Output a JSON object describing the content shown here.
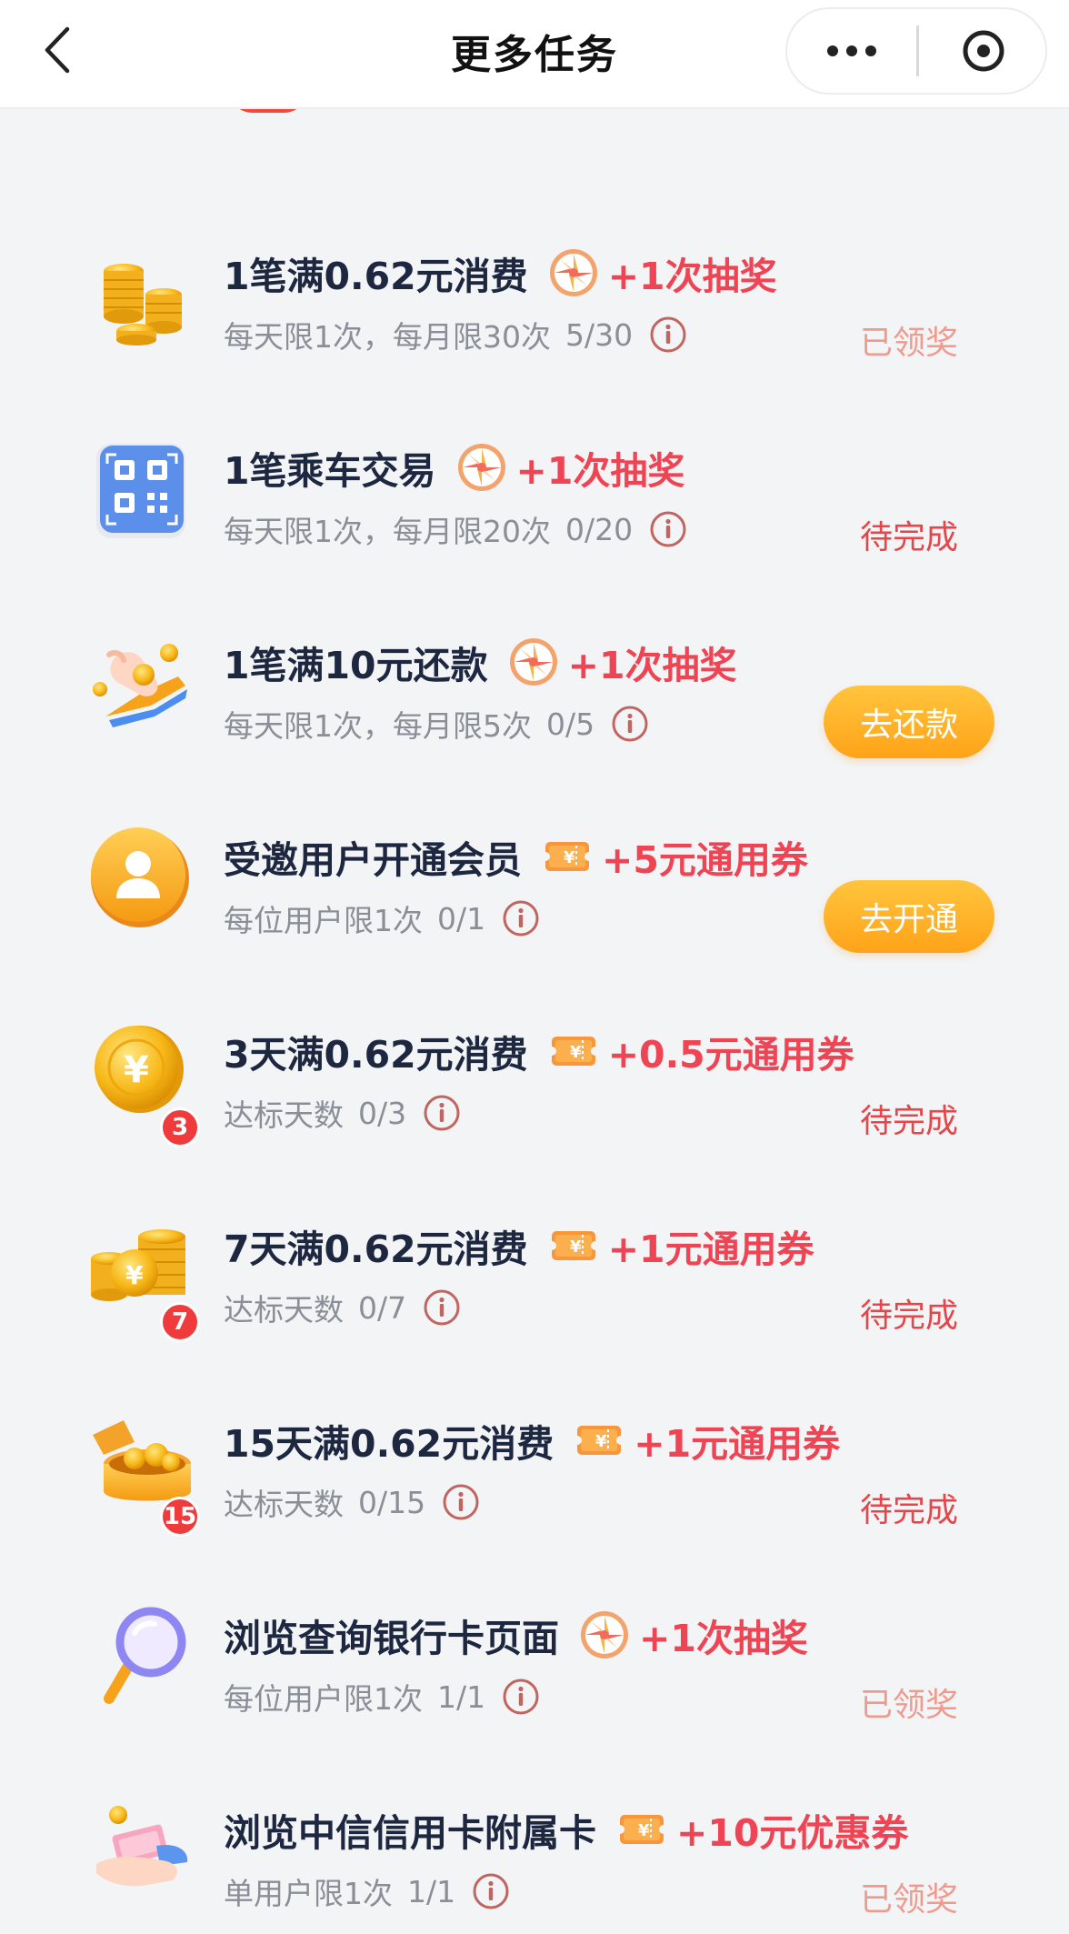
{
  "header": {
    "title": "更多任务"
  },
  "tasks": [
    {
      "title": "1笔满0.62元消费",
      "reward_type": "lottery",
      "reward": "+1次抽奖",
      "limit": "每天限1次，每月限30次",
      "progress": "5/30",
      "status": "已领奖",
      "status_kind": "done",
      "icon": "gold-coins-stack-icon"
    },
    {
      "title": "1笔乘车交易",
      "reward_type": "lottery",
      "reward": "+1次抽奖",
      "limit": "每天限1次，每月限20次",
      "progress": "0/20",
      "status": "待完成",
      "status_kind": "pending",
      "icon": "qr-code-icon"
    },
    {
      "title": "1笔满10元还款",
      "reward_type": "lottery",
      "reward": "+1次抽奖",
      "limit": "每天限1次，每月限5次",
      "progress": "0/5",
      "action": "去还款",
      "icon": "hand-with-coins-icon"
    },
    {
      "title": "受邀用户开通会员",
      "reward_type": "coupon",
      "reward": "+5元通用券",
      "limit": "每位用户限1次",
      "progress": "0/1",
      "action": "去开通",
      "icon": "user-avatar-icon"
    },
    {
      "title": "3天满0.62元消费",
      "reward_type": "coupon",
      "reward": "+0.5元通用券",
      "limit": "达标天数",
      "progress": "0/3",
      "status": "待完成",
      "status_kind": "pending",
      "icon": "yuan-coin-icon",
      "badge": "3"
    },
    {
      "title": "7天满0.62元消费",
      "reward_type": "coupon",
      "reward": "+1元通用券",
      "limit": "达标天数",
      "progress": "0/7",
      "status": "待完成",
      "status_kind": "pending",
      "icon": "coin-stacks-icon",
      "badge": "7"
    },
    {
      "title": "15天满0.62元消费",
      "reward_type": "coupon",
      "reward": "+1元通用券",
      "limit": "达标天数",
      "progress": "0/15",
      "status": "待完成",
      "status_kind": "pending",
      "icon": "treasure-box-icon",
      "badge": "15"
    },
    {
      "title": "浏览查询银行卡页面",
      "reward_type": "lottery",
      "reward": "+1次抽奖",
      "limit": "每位用户限1次",
      "progress": "1/1",
      "status": "已领奖",
      "status_kind": "done",
      "icon": "magnifier-icon"
    },
    {
      "title": "浏览中信信用卡附属卡",
      "reward_type": "coupon",
      "reward": "+10元优惠券",
      "limit": "单用户限1次",
      "progress": "1/1",
      "status": "已领奖",
      "status_kind": "done",
      "icon": "hand-with-cash-icon"
    }
  ],
  "colors": {
    "reward_red": "#ee4454",
    "pending_red": "#e8454a",
    "done_pink": "#f09a8e",
    "button_orange": "#ffa319",
    "background": "#f3f4f6"
  }
}
